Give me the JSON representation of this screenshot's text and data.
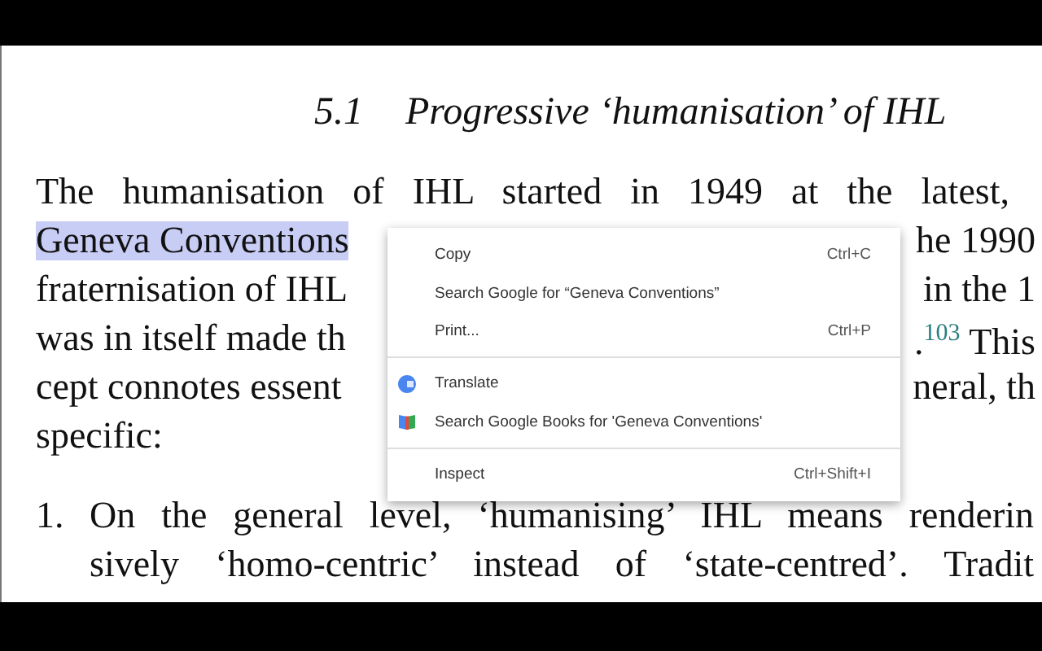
{
  "heading": {
    "number": "5.1",
    "title": "Progressive ‘humanisation’ of IHL"
  },
  "paragraph": [
    {
      "left": "The humanisation of IHL started in 1949 at the latest,",
      "selected": false
    },
    {
      "left": "Geneva Conventions",
      "right": "he 1990",
      "selected": true
    },
    {
      "left": "fraternisation of IHL",
      "right": "in the 1",
      "selected": false
    },
    {
      "left": "was in itself made th",
      "right": ".$^{103}$ This",
      "selected": false
    },
    {
      "left": "cept connotes essent",
      "right": "neral, th",
      "selected": false
    },
    {
      "left": "specific:",
      "selected": false
    }
  ],
  "list": [
    {
      "marker": "1.",
      "lines": [
        "On the general level, ‘humanising’ IHL means renderin",
        "sively ‘homo-centric’ instead of ‘state-centred’. Tradit"
      ]
    }
  ],
  "context_menu": {
    "groups": [
      [
        {
          "label": "Copy",
          "shortcut": "Ctrl+C",
          "kind": "plain"
        },
        {
          "label": "Search Google for “Geneva Conventions”",
          "kind": "plain"
        },
        {
          "label": "Print...",
          "shortcut": "Ctrl+P",
          "kind": "plain"
        }
      ],
      [
        {
          "label": "Translate",
          "kind": "translate"
        },
        {
          "label": "Search Google Books for 'Geneva Conventions'",
          "kind": "books"
        }
      ],
      [
        {
          "label": "Inspect",
          "shortcut": "Ctrl+Shift+I",
          "kind": "plain"
        }
      ]
    ]
  }
}
